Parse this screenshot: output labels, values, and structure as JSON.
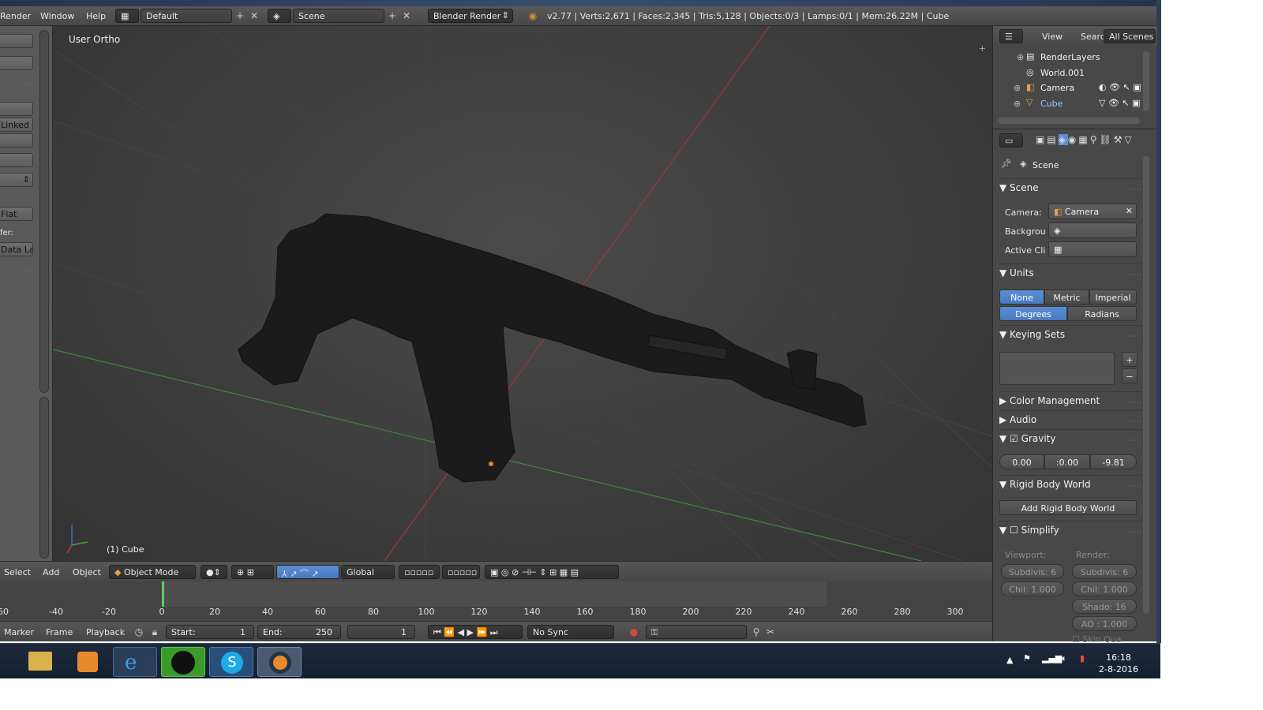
{
  "topbar": {
    "menus": [
      "Render",
      "Window",
      "Help"
    ],
    "layout_value": "Default",
    "scene_value": "Scene",
    "engine_value": "Blender Render",
    "stats": "v2.77 | Verts:2,671 | Faces:2,345 | Tris:5,128 | Objects:0/3 | Lamps:0/1 | Mem:26.22M | Cube"
  },
  "left_strip": {
    "button_linked": "Linked",
    "button_flat": "Flat",
    "label_fer": "fer:",
    "button_data": "Data La"
  },
  "viewport": {
    "title": "User Ortho",
    "object_label": "(1) Cube"
  },
  "viewport_header": {
    "menus": [
      "Select",
      "Add",
      "Object"
    ],
    "mode": "Object Mode",
    "orientation": "Global"
  },
  "timeline": {
    "ticks": [
      "60",
      "-40",
      "-20",
      "0",
      "20",
      "40",
      "60",
      "80",
      "100",
      "120",
      "140",
      "160",
      "180",
      "200",
      "220",
      "240",
      "260",
      "280",
      "300"
    ],
    "current_frame": 1,
    "range_start": 0,
    "range_end": 250
  },
  "timeline_header": {
    "menus": [
      "Marker",
      "Frame",
      "Playback"
    ],
    "start_label": "Start:",
    "start_value": "1",
    "end_label": "End:",
    "end_value": "250",
    "current": "1",
    "sync": "No Sync"
  },
  "outliner": {
    "menus": [
      "View",
      "Search",
      "All Scenes"
    ],
    "items": [
      "RenderLayers",
      "World.001",
      "Camera",
      "Cube"
    ]
  },
  "properties": {
    "breadcrumb": "Scene",
    "scene_panel": "Scene",
    "camera_label": "Camera:",
    "camera_value": "Camera",
    "background_label": "Backgrou",
    "active_clip_label": "Active Cli",
    "units_panel": "Units",
    "unit_options": [
      "None",
      "Metric",
      "Imperial"
    ],
    "rotation_options": [
      "Degrees",
      "Radians"
    ],
    "keying_sets_panel": "Keying Sets",
    "color_mgmt_panel": "Color Management",
    "audio_panel": "Audio",
    "gravity_panel": "Gravity",
    "gravity_values": [
      "0.00",
      ":0.00",
      "-9.81"
    ],
    "rigid_body_panel": "Rigid Body World",
    "add_rigid_body": "Add Rigid Body World",
    "simplify_panel": "Simplify",
    "viewport_label": "Viewport:",
    "render_label": "Render:",
    "subdiv_vp": "Subdivis: 6",
    "subdiv_r": "Subdivis: 6",
    "child_vp": "Chil: 1.000",
    "child_r": "Chil: 1.000",
    "shadow": "Shado:  16",
    "ao": "AO : 1.000",
    "skin": "Skin Qua"
  },
  "taskbar": {
    "time": "16:18",
    "date": "2-8-2016"
  },
  "colors": {
    "accent_blue": "#4a78c0",
    "timeline_cursor": "#5fcf5f",
    "axis_x": "#b03a3a",
    "axis_y": "#3a9a3a"
  }
}
